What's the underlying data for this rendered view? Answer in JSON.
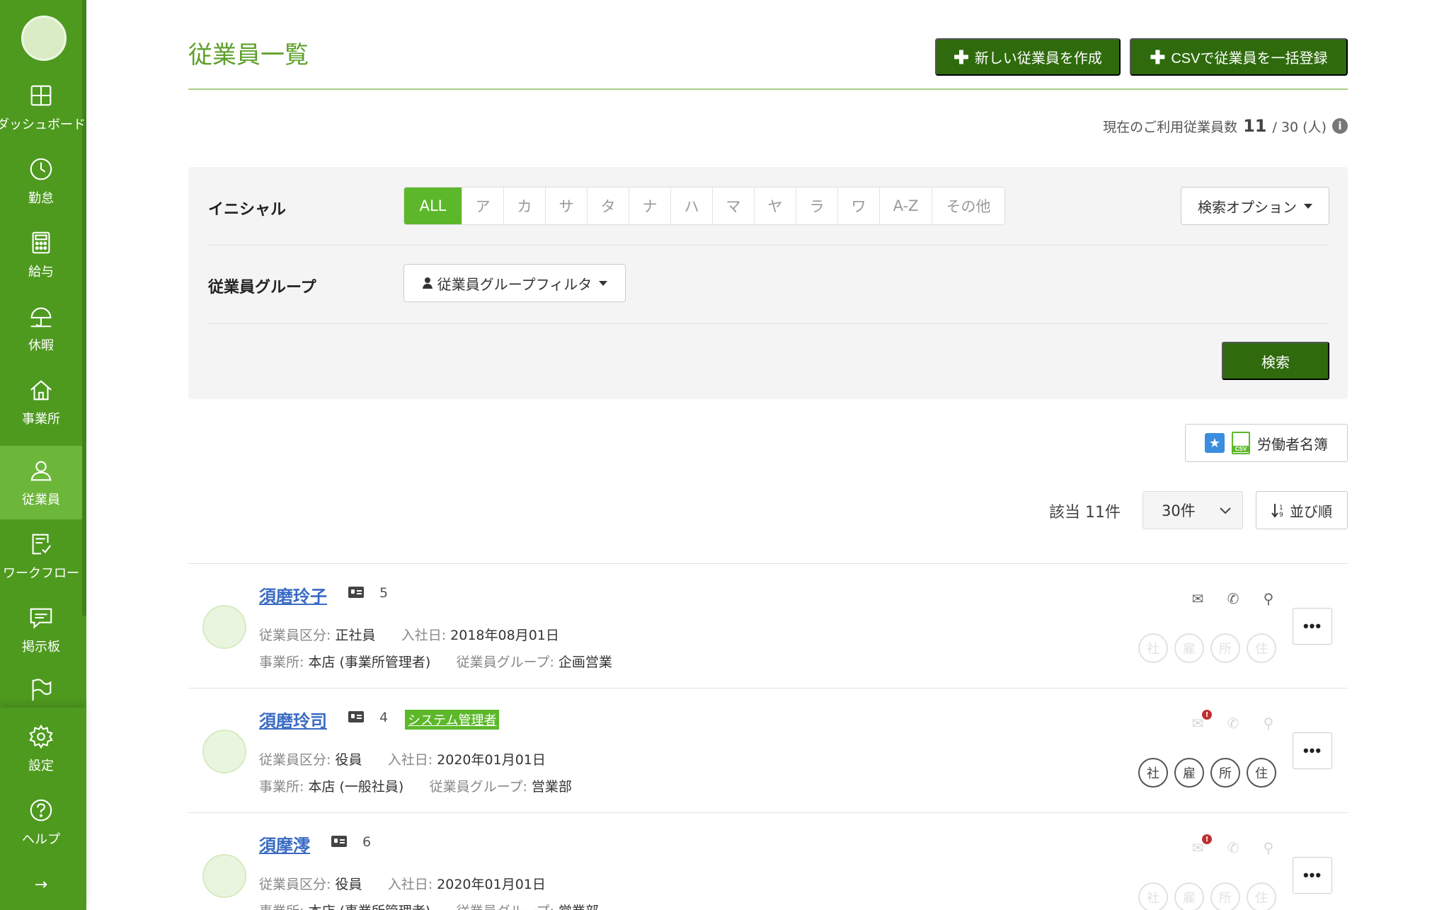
{
  "sidebar": {
    "items": [
      {
        "label": "ダッシュボード",
        "icon": "dashboard-icon"
      },
      {
        "label": "勤怠",
        "icon": "clock-icon"
      },
      {
        "label": "給与",
        "icon": "calculator-icon"
      },
      {
        "label": "休暇",
        "icon": "umbrella-icon"
      },
      {
        "label": "事業所",
        "icon": "home-icon"
      },
      {
        "label": "従業員",
        "icon": "user-icon"
      },
      {
        "label": "ワークフロー",
        "icon": "clipboard-check-icon"
      },
      {
        "label": "掲示板",
        "icon": "message-icon"
      }
    ],
    "bottom": [
      {
        "label": "設定",
        "icon": "gear-icon"
      },
      {
        "label": "ヘルプ",
        "icon": "help-icon"
      }
    ],
    "expand_icon": "→",
    "accent": "#4e9a1f"
  },
  "header": {
    "title": "従業員一覧",
    "new_employee_label": "新しい従業員を作成",
    "csv_import_label": "CSVで従業員を一括登録",
    "plus_glyph": "✚"
  },
  "usage": {
    "prefix": "現在のご利用従業員数",
    "current": "11",
    "suffix": "/ 30 (人)",
    "info_glyph": "i"
  },
  "filter": {
    "initial_label": "イニシャル",
    "initials": [
      "ALL",
      "ア",
      "カ",
      "サ",
      "タ",
      "ナ",
      "ハ",
      "マ",
      "ヤ",
      "ラ",
      "ワ",
      "A-Z",
      "その他"
    ],
    "search_options_label": "検索オプション",
    "group_label": "従業員グループ",
    "group_filter_label": "従業員グループフィルタ",
    "search_button_label": "検索"
  },
  "register": {
    "label": "労働者名簿",
    "csv_tag": "CSV"
  },
  "results": {
    "count_label": "該当 11件",
    "per_page": "30件",
    "sort_label": "並び順"
  },
  "employees": [
    {
      "name": "須磨玲子",
      "id_num": "5",
      "badge": "",
      "type_label": "従業員区分:",
      "type": "正社員",
      "join_label": "入社日:",
      "join_date": "2018年08月01日",
      "office_label": "事業所:",
      "office": "本店 (事業所管理者)",
      "group_label": "従業員グループ:",
      "group": "企画営業",
      "circles": [
        "社",
        "雇",
        "所",
        "住"
      ]
    },
    {
      "name": "須磨玲司",
      "id_num": "4",
      "badge": "システム管理者",
      "type_label": "従業員区分:",
      "type": "役員",
      "join_label": "入社日:",
      "join_date": "2020年01月01日",
      "office_label": "事業所:",
      "office": "本店 (一般社員)",
      "group_label": "従業員グループ:",
      "group": "営業部",
      "circles": [
        "社",
        "雇",
        "所",
        "住"
      ]
    },
    {
      "name": "須摩澪",
      "id_num": "6",
      "badge": "",
      "type_label": "従業員区分:",
      "type": "役員",
      "join_label": "入社日:",
      "join_date": "2020年01月01日",
      "office_label": "事業所:",
      "office": "本店 (事業所管理者)",
      "group_label": "従業員グループ:",
      "group": "営業部",
      "circles": [
        "社",
        "雇",
        "所",
        "住"
      ]
    }
  ],
  "more_glyph": "•••",
  "alert_glyph": "!"
}
